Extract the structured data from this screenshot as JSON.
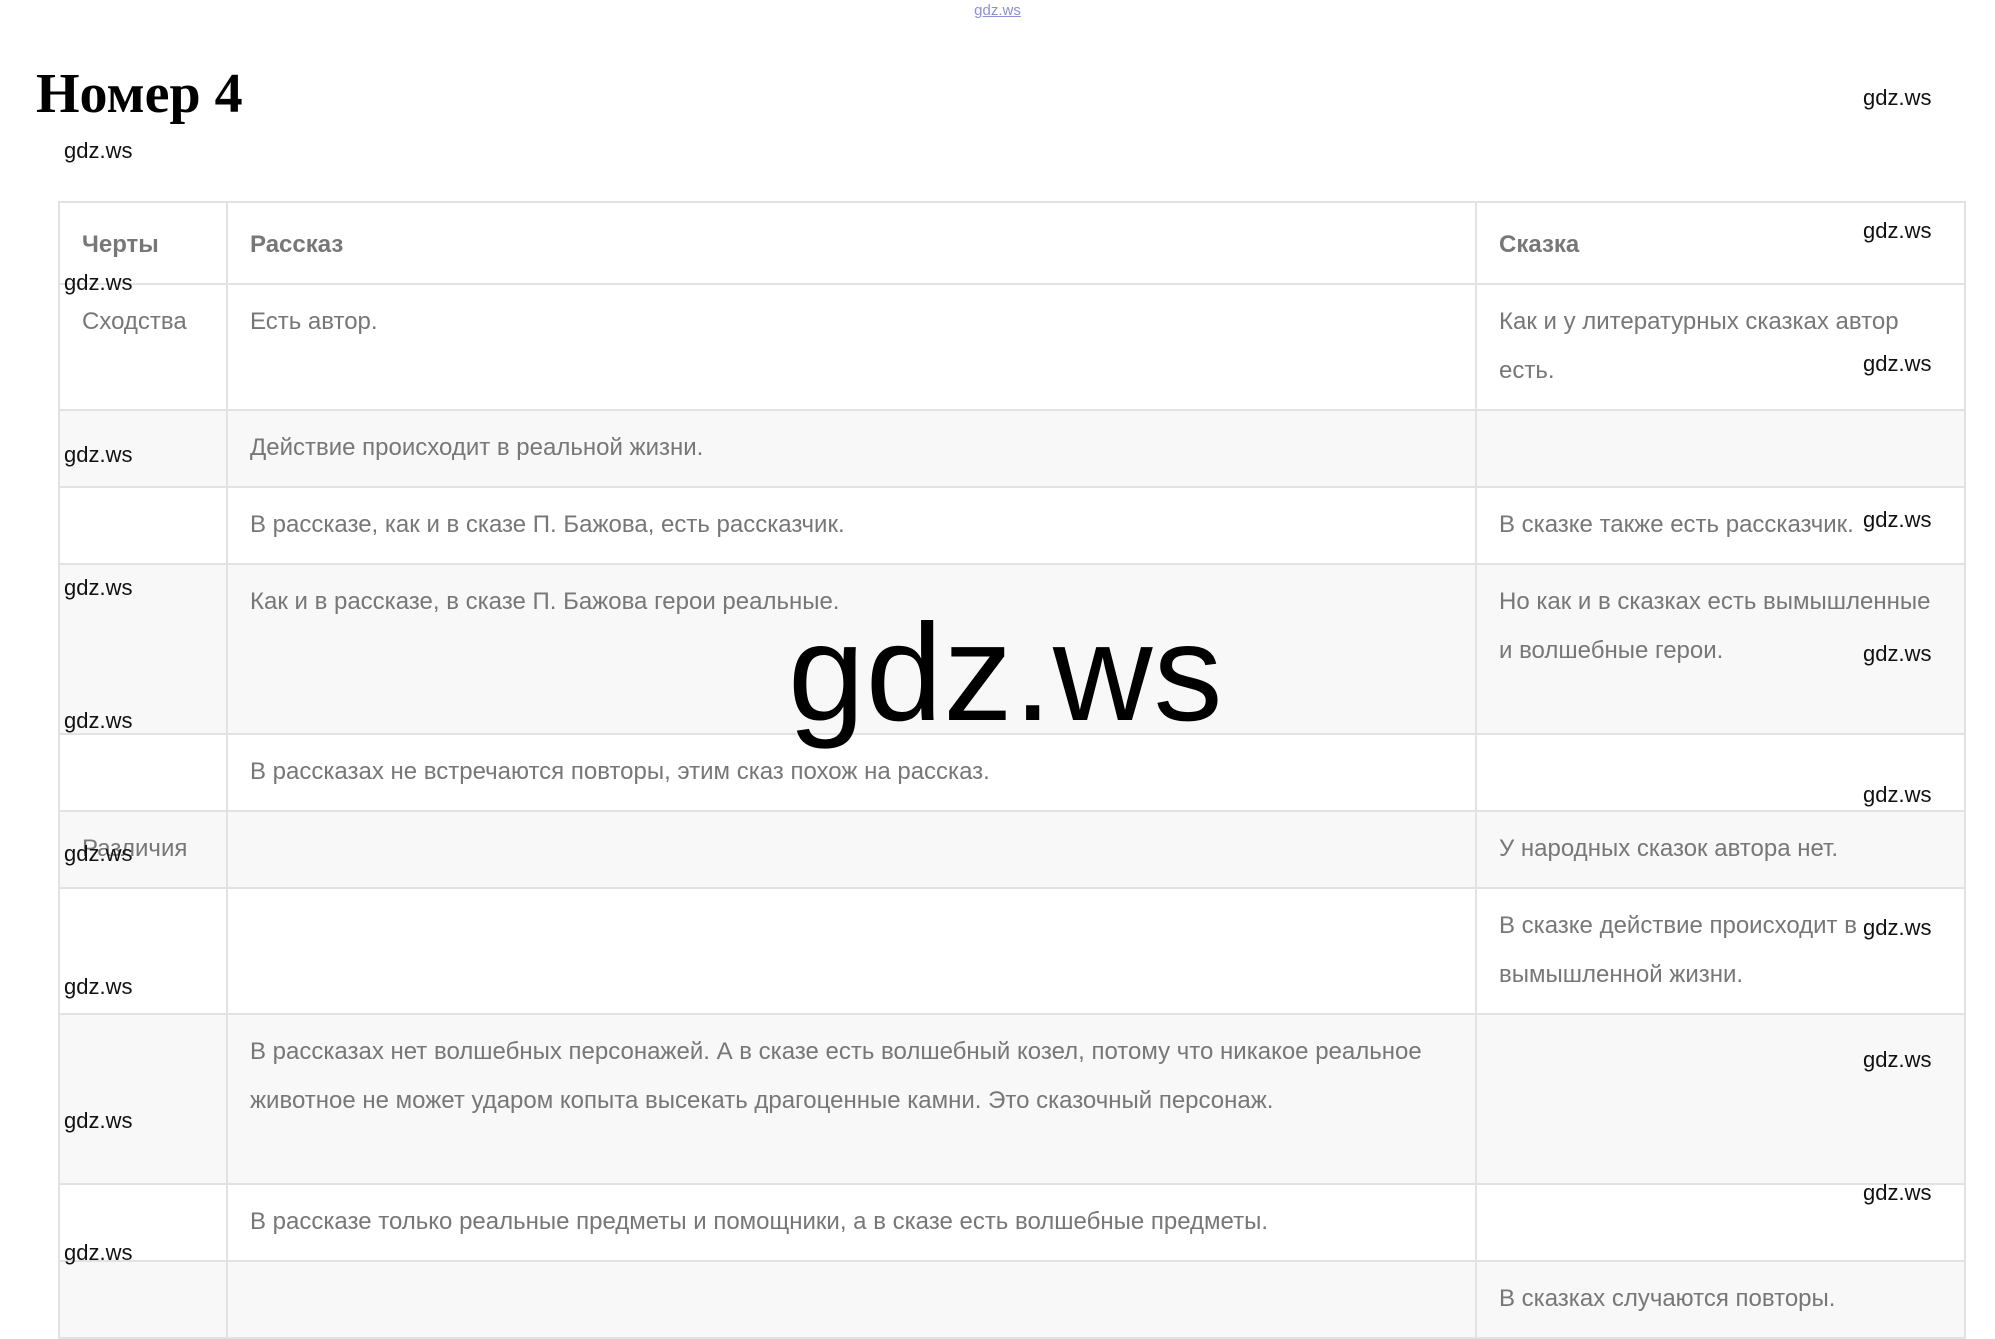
{
  "top_watermark": "gdz.ws",
  "page_title": "Номер 4",
  "table": {
    "headers": [
      "Черты",
      "Рассказ",
      "Сказка"
    ],
    "rows": [
      [
        "Сходства",
        "Есть автор.",
        "Как и у литературных сказках автор есть."
      ],
      [
        "",
        "Действие происходит в реальной жизни.",
        ""
      ],
      [
        "",
        "В рассказе, как и в сказе П. Бажова, есть рассказчик.",
        "В сказке также есть рассказчик."
      ],
      [
        "",
        "Как и в рассказе, в сказе П. Бажова герои реальные.",
        "Но как и в сказках есть вымышленные и волшебные герои."
      ],
      [
        "",
        "В рассказах не встречаются повторы, этим сказ похож на рассказ.",
        ""
      ],
      [
        "Различия",
        "",
        "У народных сказок автора нет."
      ],
      [
        "",
        "",
        "В сказке действие происходит в вымышленной жизни."
      ],
      [
        "",
        "В рассказах нет волшебных персонажей. А в сказе есть волшебный козел, потому что никакое реальное животное не может ударом копыта высекать драгоценные камни. Это сказочный персонаж.",
        ""
      ],
      [
        "",
        "В рассказе только реальные предметы и помощники, а в сказе есть волшебные предметы.",
        ""
      ],
      [
        "",
        "",
        "В сказках случаются повторы."
      ]
    ]
  },
  "watermarks": {
    "text": "gdz.ws",
    "center_text": "gdz.ws"
  }
}
